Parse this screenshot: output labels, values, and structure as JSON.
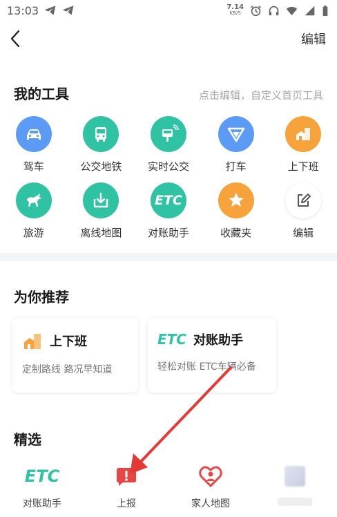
{
  "status_bar": {
    "time": "13:03",
    "net_speed": "7.14",
    "net_unit": "KB/S"
  },
  "header": {
    "edit_label": "编辑"
  },
  "tools": {
    "title": "我的工具",
    "hint": "点击编辑，自定义首页工具",
    "items": [
      {
        "label": "驾车",
        "icon": "car-icon",
        "color": "#5b9bf5"
      },
      {
        "label": "公交地铁",
        "icon": "bus-icon",
        "color": "#2fc3a4"
      },
      {
        "label": "实时公交",
        "icon": "realtime-bus-icon",
        "color": "#2fc3a4"
      },
      {
        "label": "打车",
        "icon": "taxi-icon",
        "color": "#5b9bf5"
      },
      {
        "label": "上下班",
        "icon": "commute-icon",
        "color": "#f6a33c"
      },
      {
        "label": "旅游",
        "icon": "horse-icon",
        "color": "#2fc3a4"
      },
      {
        "label": "离线地图",
        "icon": "download-icon",
        "color": "#2fc3a4"
      },
      {
        "label": "对账助手",
        "icon": "etc-icon",
        "icon_text": "ETC",
        "color": "#2fc3a4"
      },
      {
        "label": "收藏夹",
        "icon": "star-icon",
        "color": "#f6a33c"
      },
      {
        "label": "编辑",
        "icon": "edit-icon",
        "color": "#ffffff"
      }
    ]
  },
  "recommend": {
    "title": "为你推荐",
    "items": [
      {
        "name": "上下班",
        "desc": "定制路线 路况早知道",
        "icon": "commute-icon"
      },
      {
        "name": "对账助手",
        "desc": "轻松对账 ETC车辆必备",
        "icon": "etc-icon",
        "icon_text": "ETC"
      }
    ]
  },
  "featured": {
    "title": "精选",
    "items": [
      {
        "label": "对账助手",
        "icon": "etc-icon",
        "icon_text": "ETC"
      },
      {
        "label": "上报",
        "icon": "report-icon"
      },
      {
        "label": "家人地图",
        "icon": "family-heart-icon"
      },
      {
        "label": "",
        "icon": "blurred-icon"
      }
    ]
  },
  "colors": {
    "teal": "#2fc3a4",
    "blue": "#5b9bf5",
    "orange": "#f6a33c",
    "red": "#e84545",
    "annotation": "#e53935"
  }
}
